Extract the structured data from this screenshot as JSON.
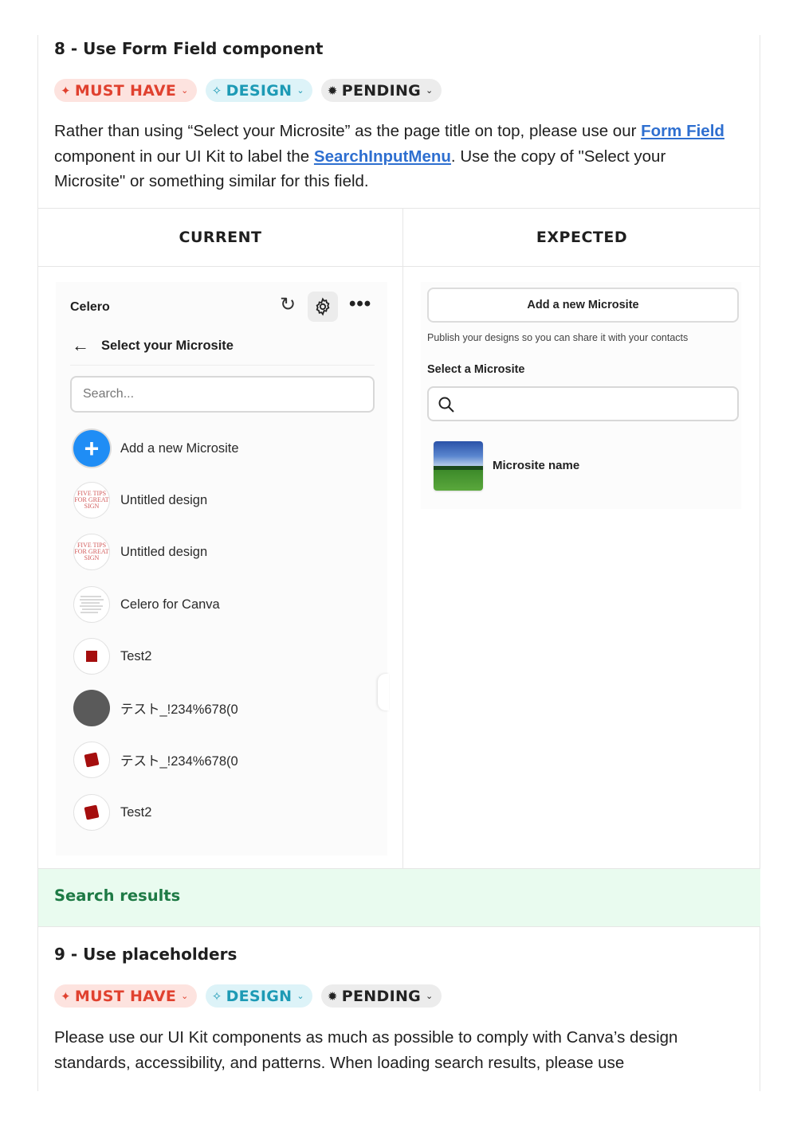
{
  "section8": {
    "title": "8 - Use Form Field component",
    "tags": {
      "must": "MUST HAVE",
      "design": "DESIGN",
      "pending": "PENDING"
    },
    "para": {
      "p1": "Rather than using “Select your Microsite” as the page title on top, please use our ",
      "link1": "Form Field",
      "p2": " component in our UI Kit to label the ",
      "link2": "SearchInputMenu",
      "p3": ". Use the copy of \"Select your Microsite\" or something similar for this field."
    }
  },
  "table": {
    "col_current": "CURRENT",
    "col_expected": "EXPECTED"
  },
  "current": {
    "brand": "Celero",
    "subtitle": "Select your Microsite",
    "search_placeholder": "Search...",
    "add_label": "Add a new Microsite",
    "items": [
      {
        "label": "Untitled design"
      },
      {
        "label": "Untitled design"
      },
      {
        "label": "Celero for Canva"
      },
      {
        "label": "Test2"
      },
      {
        "label": "テスト_!234%678(0"
      },
      {
        "label": "テスト_!234%678(0"
      },
      {
        "label": "Test2"
      }
    ],
    "thumb_text": "FIVE TIPS FOR GREAT SIGN"
  },
  "expected": {
    "add_button": "Add a new Microsite",
    "hint": "Publish your designs so you can share it with your contacts",
    "field_label": "Select a Microsite",
    "microsite_name": "Microsite name"
  },
  "search_results": "Search results",
  "section9": {
    "title": "9 - Use placeholders",
    "tags": {
      "must": "MUST HAVE",
      "design": "DESIGN",
      "pending": "PENDING"
    },
    "para": "Please use our UI Kit components as much as possible to comply with Canva’s design standards, accessibility, and patterns. When loading search results, please use"
  },
  "colors": {
    "must_bg": "#fde3df",
    "must_fg": "#e0412f",
    "design_bg": "#ddf3f8",
    "design_fg": "#1d9ab5",
    "pending_bg": "#ececec",
    "link": "#2e6fd0",
    "add_button_blue": "#1f8df5",
    "search_results_bg": "#e9fbef",
    "search_results_fg": "#1e7a45"
  }
}
